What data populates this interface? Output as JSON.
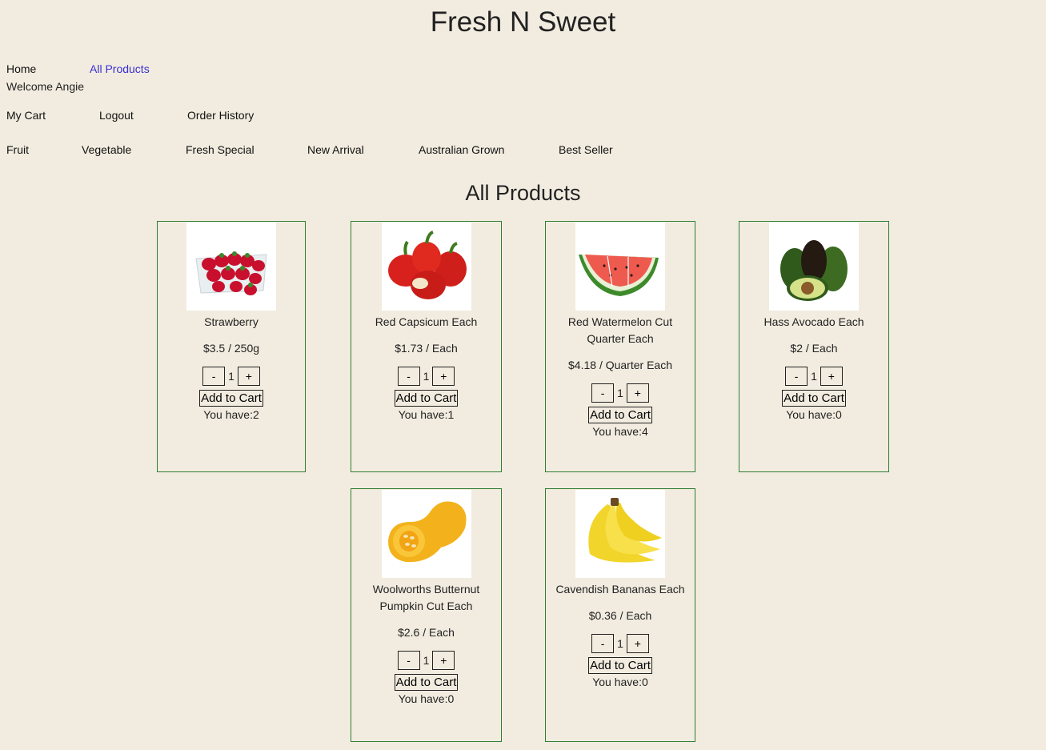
{
  "site_title": "Fresh N Sweet",
  "nav": {
    "home": "Home",
    "all_products": "All Products",
    "welcome": "Welcome Angie",
    "my_cart": "My Cart",
    "logout": "Logout",
    "order_history": "Order History"
  },
  "categories": [
    "Fruit",
    "Vegetable",
    "Fresh Special",
    "New Arrival",
    "Australian Grown",
    "Best Seller"
  ],
  "section_title": "All Products",
  "add_to_cart_label": "Add to Cart",
  "minus_label": "-",
  "plus_label": "+",
  "products": [
    {
      "name": "Strawberry",
      "price": "$3.5 / 250g",
      "qty": "1",
      "have": "You have:2",
      "image": "strawberry"
    },
    {
      "name": "Red Capsicum Each",
      "price": "$1.73 / Each",
      "qty": "1",
      "have": "You have:1",
      "image": "red-capsicum"
    },
    {
      "name": "Red Watermelon Cut Quarter Each",
      "price": "$4.18 / Quarter Each",
      "qty": "1",
      "have": "You have:4",
      "image": "watermelon"
    },
    {
      "name": "Hass Avocado Each",
      "price": "$2 / Each",
      "qty": "1",
      "have": "You have:0",
      "image": "avocado"
    },
    {
      "name": "Woolworths Butternut Pumpkin Cut Each",
      "price": "$2.6 / Each",
      "qty": "1",
      "have": "You have:0",
      "image": "butternut-pumpkin"
    },
    {
      "name": "Cavendish Bananas Each",
      "price": "$0.36 / Each",
      "qty": "1",
      "have": "You have:0",
      "image": "bananas"
    }
  ]
}
